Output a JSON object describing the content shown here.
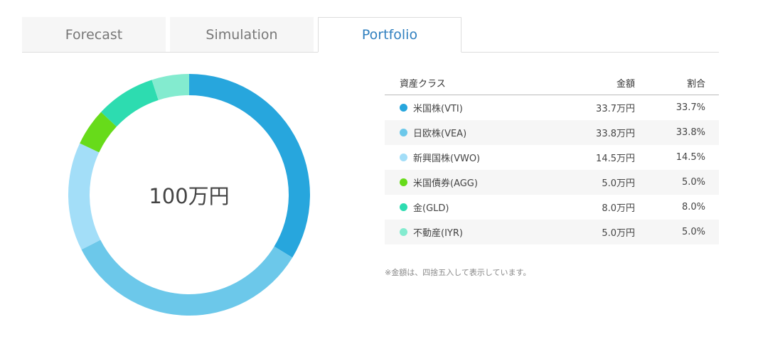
{
  "tabs": [
    {
      "label": "Forecast",
      "active": false
    },
    {
      "label": "Simulation",
      "active": false
    },
    {
      "label": "Portfolio",
      "active": true
    }
  ],
  "chart_data": {
    "type": "pie",
    "center_label": "100万円",
    "slices": [
      {
        "name": "米国株(VTI)",
        "value": 33.7,
        "color": "#27a6dd"
      },
      {
        "name": "日欧株(VEA)",
        "value": 33.8,
        "color": "#6cc8ea"
      },
      {
        "name": "新興国株(VWO)",
        "value": 14.5,
        "color": "#a3def8"
      },
      {
        "name": "米国債券(AGG)",
        "value": 5.0,
        "color": "#67db1a"
      },
      {
        "name": "金(GLD)",
        "value": 8.0,
        "color": "#2ddcb0"
      },
      {
        "name": "不動産(IYR)",
        "value": 5.0,
        "color": "#83ebcf"
      }
    ]
  },
  "table": {
    "headers": {
      "name": "資産クラス",
      "amount": "金額",
      "ratio": "割合"
    },
    "rows": [
      {
        "name": "米国株(VTI)",
        "amount": "33.7万円",
        "ratio": "33.7%",
        "color": "#27a6dd"
      },
      {
        "name": "日欧株(VEA)",
        "amount": "33.8万円",
        "ratio": "33.8%",
        "color": "#6cc8ea"
      },
      {
        "name": "新興国株(VWO)",
        "amount": "14.5万円",
        "ratio": "14.5%",
        "color": "#a3def8"
      },
      {
        "name": "米国債券(AGG)",
        "amount": "5.0万円",
        "ratio": "5.0%",
        "color": "#67db1a"
      },
      {
        "name": "金(GLD)",
        "amount": "8.0万円",
        "ratio": "8.0%",
        "color": "#2ddcb0"
      },
      {
        "name": "不動産(IYR)",
        "amount": "5.0万円",
        "ratio": "5.0%",
        "color": "#83ebcf"
      }
    ]
  },
  "note": "※金額は、四捨五入して表示しています。"
}
